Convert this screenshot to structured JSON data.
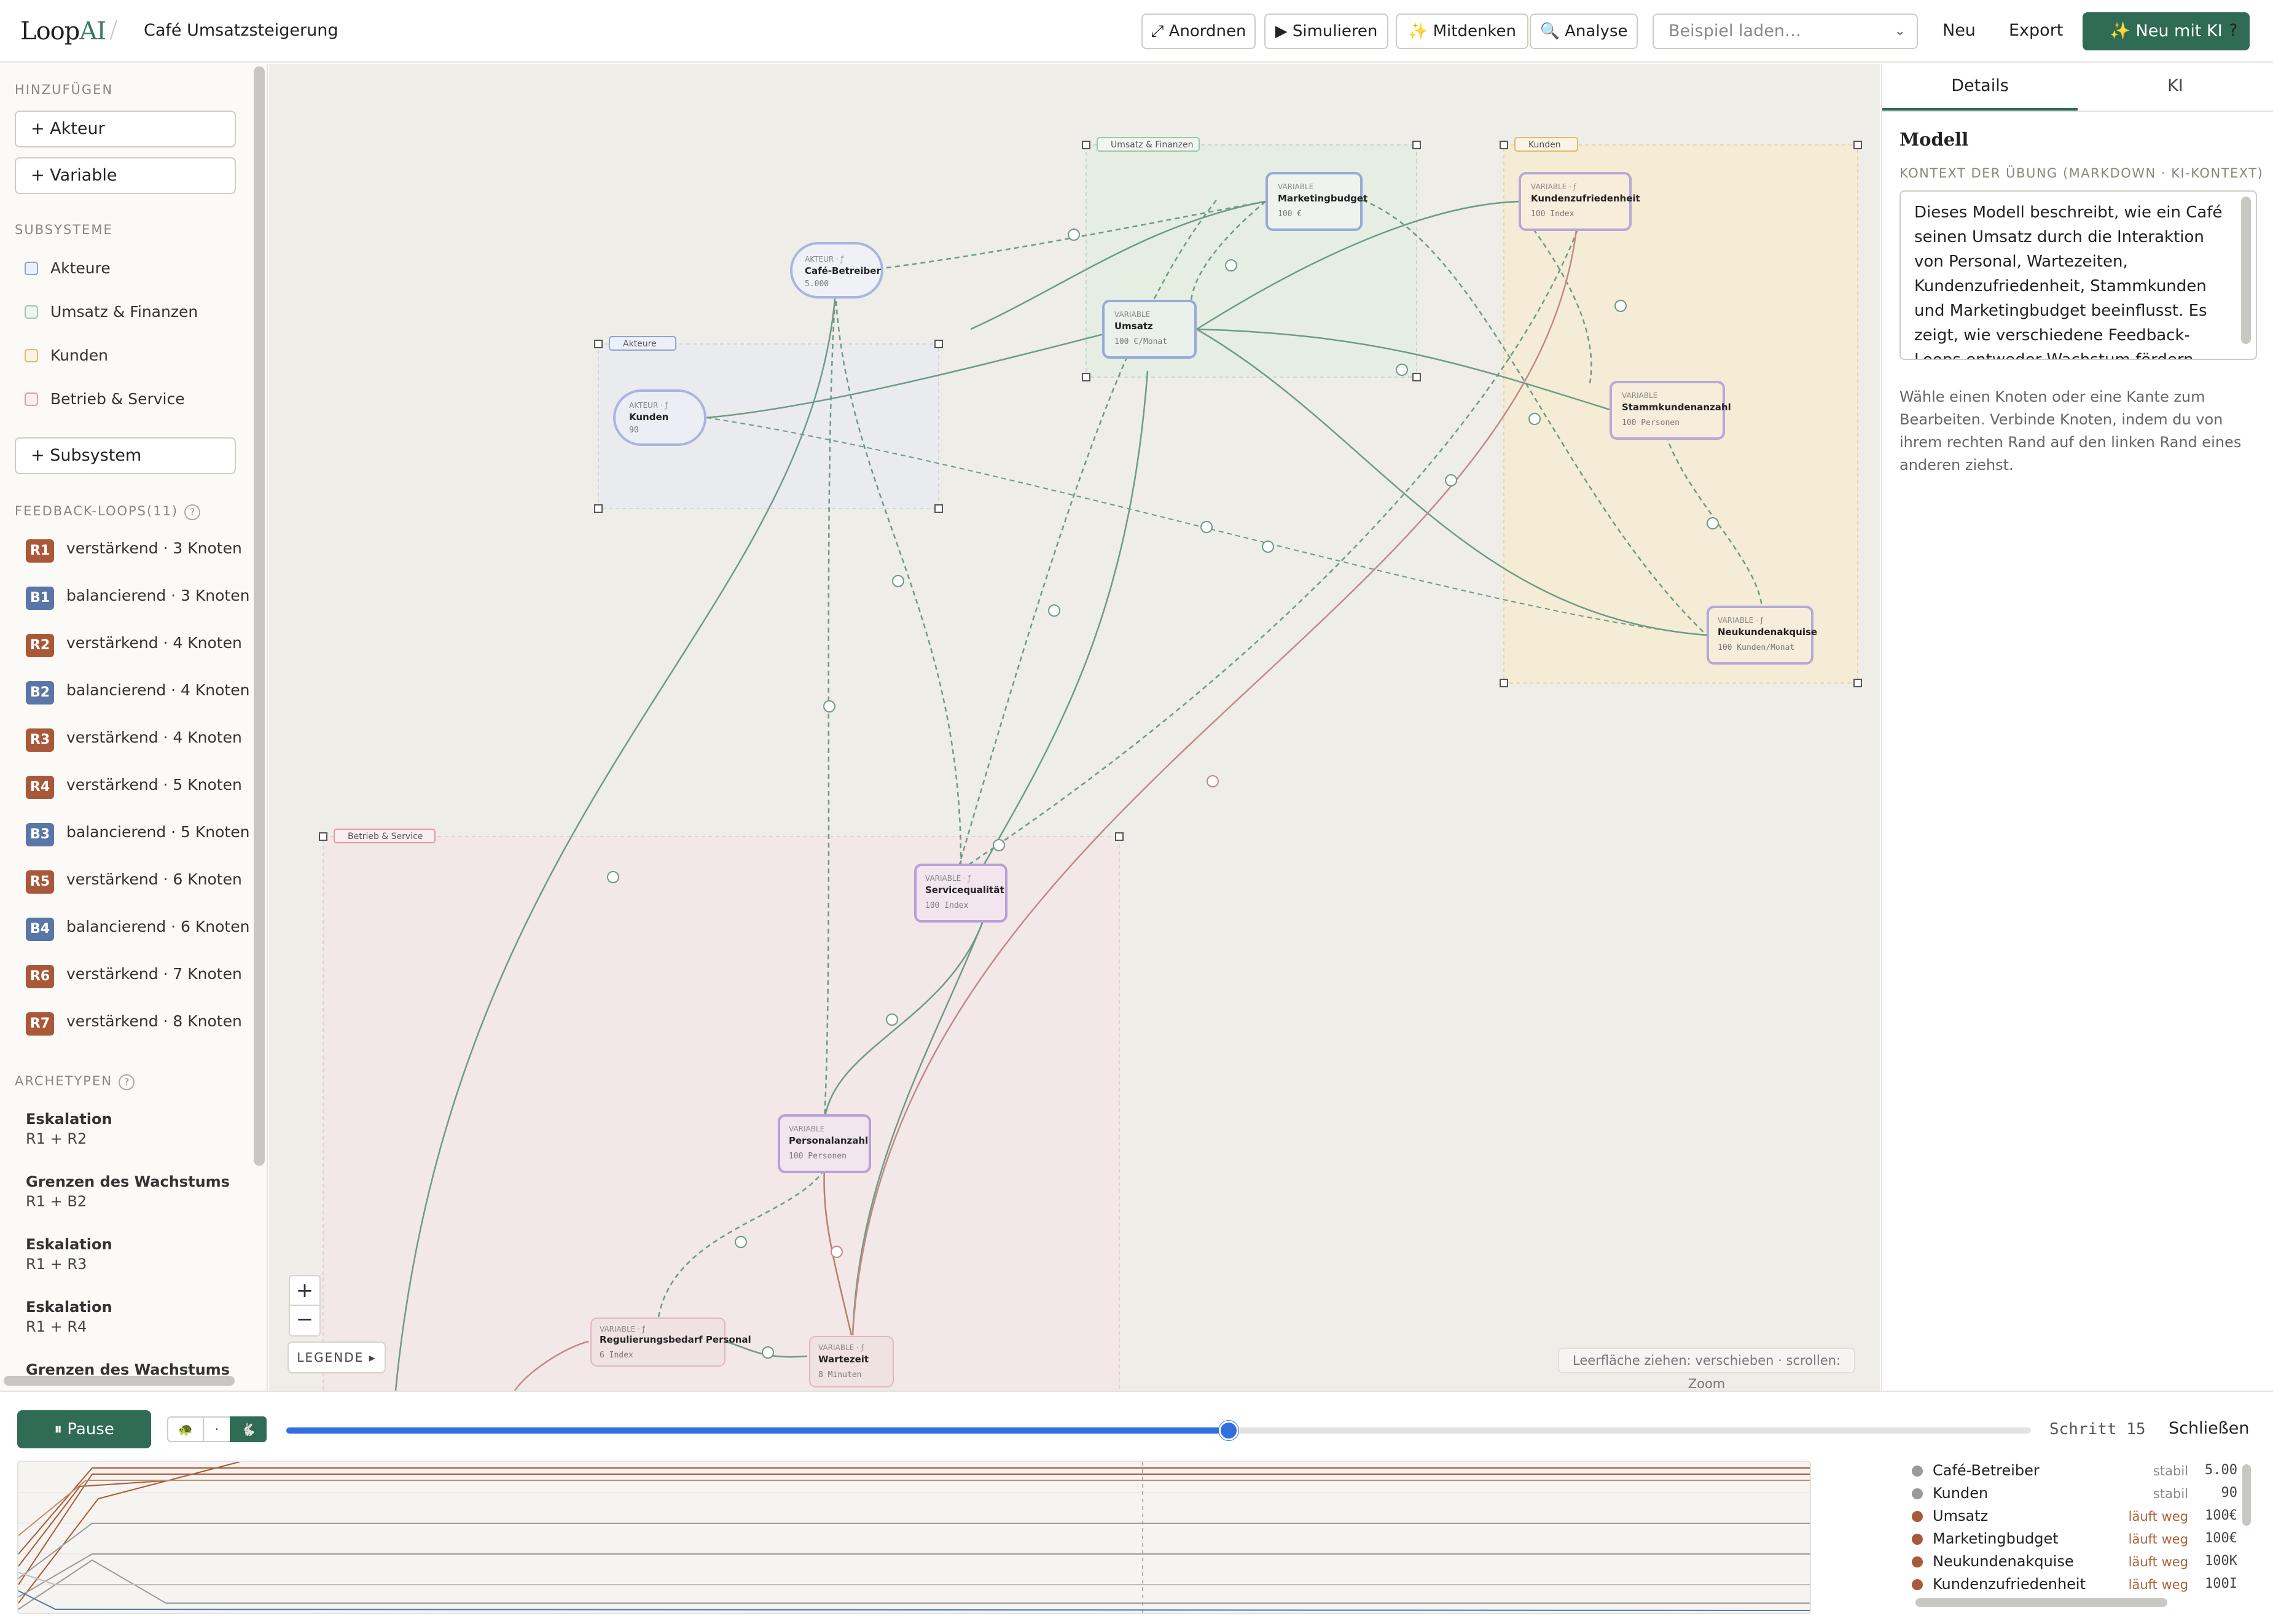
{
  "header": {
    "logo_main": "Loop",
    "logo_accent": "AI",
    "separator": "/",
    "title": "Café Umsatzsteigerung",
    "buttons": [
      {
        "label": "⤢ Anordnen"
      },
      {
        "label": "▶ Simulieren"
      },
      {
        "label": "✨ Mitdenken"
      },
      {
        "label": "🔍 Analyse"
      }
    ],
    "example_select": {
      "placeholder": "Beispiel laden…"
    },
    "new_label": "Neu",
    "export_label": "Export",
    "ai_new_label": "✨ Neu mit KI",
    "help_label": "?"
  },
  "sidebar": {
    "add_section": "HINZUFÜGEN",
    "add_actor": "+ Akteur",
    "add_variable": "+ Variable",
    "subsystems_section": "SUBSYSTEME",
    "subsystems": [
      {
        "label": "Akteure",
        "color": "#8fa3d8"
      },
      {
        "label": "Umsatz & Finanzen",
        "color": "#9cc7a8"
      },
      {
        "label": "Kunden",
        "color": "#e2b96a"
      },
      {
        "label": "Betrieb & Service",
        "color": "#e39aa6"
      }
    ],
    "add_subsystem": "+ Subsystem",
    "loops_section": "FEEDBACK-LOOPS(11)",
    "loops_help": "?",
    "loops": [
      {
        "badge": "R1",
        "text": "verstärkend · 3 Knoten",
        "color": "#a9593a"
      },
      {
        "badge": "B1",
        "text": "balancierend · 3 Knoten",
        "color": "#5a76a6"
      },
      {
        "badge": "R2",
        "text": "verstärkend · 4 Knoten",
        "color": "#a9593a"
      },
      {
        "badge": "B2",
        "text": "balancierend · 4 Knoten",
        "color": "#5a76a6"
      },
      {
        "badge": "R3",
        "text": "verstärkend · 4 Knoten",
        "color": "#a9593a"
      },
      {
        "badge": "R4",
        "text": "verstärkend · 5 Knoten",
        "color": "#a9593a"
      },
      {
        "badge": "B3",
        "text": "balancierend · 5 Knoten",
        "color": "#5a76a6"
      },
      {
        "badge": "R5",
        "text": "verstärkend · 6 Knoten",
        "color": "#a9593a"
      },
      {
        "badge": "B4",
        "text": "balancierend · 6 Knoten",
        "color": "#5a76a6"
      },
      {
        "badge": "R6",
        "text": "verstärkend · 7 Knoten",
        "color": "#a9593a"
      },
      {
        "badge": "R7",
        "text": "verstärkend · 8 Knoten",
        "color": "#a9593a"
      }
    ],
    "archetypes_section": "ARCHETYPEN",
    "archetypes_help": "?",
    "archetypes": [
      {
        "name": "Eskalation",
        "loops": "R1 + R2"
      },
      {
        "name": "Grenzen des Wachstums",
        "loops": "R1 + B2"
      },
      {
        "name": "Eskalation",
        "loops": "R1 + R3"
      },
      {
        "name": "Eskalation",
        "loops": "R1 + R4"
      },
      {
        "name": "Grenzen des Wachstums",
        "loops": ""
      }
    ]
  },
  "canvas": {
    "groups": [
      {
        "label": "Umsatz & Finanzen",
        "color": "#9cc7a8"
      },
      {
        "label": "Kunden",
        "color": "#e2b96a"
      },
      {
        "label": "Akteure",
        "color": "#8fa3d8"
      },
      {
        "label": "Betrieb & Service",
        "color": "#e39aa6"
      }
    ],
    "nodes": [
      {
        "kind": "AKTEUR · ƒ",
        "name": "Café-Betreiber",
        "value": "5.000"
      },
      {
        "kind": "AKTEUR · ƒ",
        "name": "Kunden",
        "value": "90"
      },
      {
        "kind": "VARIABLE",
        "name": "Marketingbudget",
        "value": "100 €"
      },
      {
        "kind": "VARIABLE · ƒ",
        "name": "Kundenzufriedenheit",
        "value": "100 Index"
      },
      {
        "kind": "VARIABLE",
        "name": "Umsatz",
        "value": "100 €/Monat"
      },
      {
        "kind": "VARIABLE",
        "name": "Stammkundenanzahl",
        "value": "100 Personen"
      },
      {
        "kind": "VARIABLE · ƒ",
        "name": "Neukundenakquise",
        "value": "100 Kunden/Monat"
      },
      {
        "kind": "VARIABLE · ƒ",
        "name": "Servicequalität",
        "value": "100 Index"
      },
      {
        "kind": "VARIABLE",
        "name": "Personalanzahl",
        "value": "100 Personen"
      },
      {
        "kind": "VARIABLE · ƒ",
        "name": "Regulierungsbedarf Personal",
        "value": "6 Index"
      },
      {
        "kind": "VARIABLE · ƒ",
        "name": "Wartezeit",
        "value": "8 Minuten"
      }
    ],
    "zoom_in": "+",
    "zoom_out": "−",
    "legend_label": "LEGENDE ▸",
    "hint": "Leerfläche ziehen: verschieben · scrollen: Zoom"
  },
  "details": {
    "tabs": [
      "Details",
      "KI"
    ],
    "model_title": "Modell",
    "context_label": "KONTEXT DER ÜBUNG (MARKDOWN · KI-KONTEXT)",
    "context_text": "Dieses Modell beschreibt, wie ein Café seinen Umsatz durch die Interaktion von Personal, Wartezeiten, Kundenzufriedenheit, Stammkunden und Marketingbudget beeinflusst. Es zeigt, wie verschiedene Feedback-Loops entweder Wachstum fördern oder zu Stabilität führen.",
    "help_text": "Wähle einen Knoten oder eine Kante zum Bearbeiten. Verbinde Knoten, indem du von ihrem rechten Rand auf den linken Rand eines anderen ziehst."
  },
  "simulation": {
    "pause_label": "⏸ Pause",
    "speeds": [
      "🐢",
      "·",
      "🐇"
    ],
    "progress": 0.54,
    "step_label": "Schritt 15",
    "close_label": "Schließen",
    "legend": [
      {
        "name": "Café-Betreiber",
        "status": "stabil",
        "value": "5.00",
        "color": "#9a9a9a",
        "status_color": "#8a8a8a"
      },
      {
        "name": "Kunden",
        "status": "stabil",
        "value": "90",
        "color": "#9a9a9a",
        "status_color": "#8a8a8a"
      },
      {
        "name": "Umsatz",
        "status": "läuft weg",
        "value": "100€",
        "color": "#a9593a",
        "status_color": "#b0603a"
      },
      {
        "name": "Marketingbudget",
        "status": "läuft weg",
        "value": "100€",
        "color": "#a9593a",
        "status_color": "#b0603a"
      },
      {
        "name": "Neukundenakquise",
        "status": "läuft weg",
        "value": "100K",
        "color": "#a9593a",
        "status_color": "#b0603a"
      },
      {
        "name": "Kundenzufriedenheit",
        "status": "läuft weg",
        "value": "100I",
        "color": "#a9593a",
        "status_color": "#b0603a"
      }
    ]
  }
}
